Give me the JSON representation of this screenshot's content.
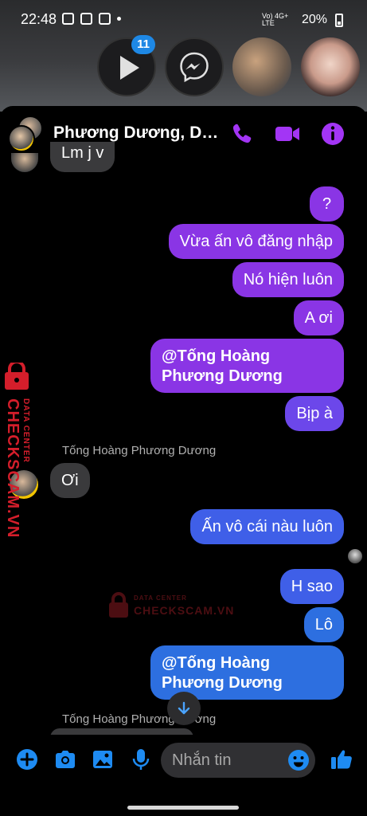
{
  "status_bar": {
    "time": "22:48",
    "battery": "20%",
    "network": "Vo) 4G+ LTE"
  },
  "chat_heads": {
    "badge_count": "11"
  },
  "header": {
    "title": "Phương Dương, Duy..."
  },
  "messages": {
    "top_partial": "Lm j v",
    "out1": "?",
    "out2": "Vừa ấn vô đăng nhập",
    "out3": "Nó hiện luôn",
    "out4": "A ơi",
    "out5": "@Tống Hoàng Phương Dương",
    "out6": "Bịp à",
    "sender1": "Tống Hoàng Phương Dương",
    "in1": "Ơi",
    "out7": "Ấn vô cái nàu luôn",
    "out8": "H sao",
    "out9": "Lô",
    "out10": "@Tống Hoàng Phương Dương",
    "sender2": "Tống Hoàng Phương Dương"
  },
  "composer": {
    "placeholder": "Nhắn tin"
  },
  "watermark": {
    "brand": "CHECKSCAM.VN",
    "sub": "DATA CENTER"
  },
  "colors": {
    "accent": "#a335f5",
    "composer_icon": "#1e8bf2",
    "out_purple": "#8a35e5",
    "out_blue": "#3f5fe8",
    "incoming": "#3a3a3c"
  },
  "icons": [
    "play-icon",
    "messenger-icon",
    "phone-icon",
    "video-icon",
    "info-icon",
    "arrow-down-icon",
    "plus-icon",
    "camera-icon",
    "image-icon",
    "mic-icon",
    "emoji-icon",
    "thumbs-up-icon"
  ]
}
